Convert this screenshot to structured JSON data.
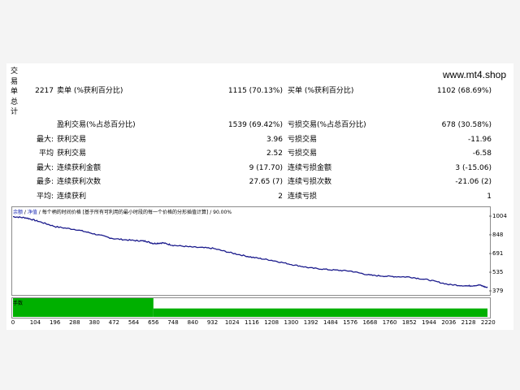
{
  "side_label": "交易单总计",
  "site": "www.mt4.shop",
  "rows": [
    {
      "c1": "2217",
      "c2": "卖单 (%获利百分比)",
      "c3": "1115 (70.13%)",
      "c4": "买单 (%获利百分比)",
      "c5": "1102 (68.69%)"
    },
    {
      "c1": "",
      "c2": "盈利交易(%占总百分比)",
      "c3": "1539 (69.42%)",
      "c4": "亏损交易(%占总百分比)",
      "c5": "678 (30.58%)"
    },
    {
      "c1": "最大:",
      "c2": "获利交易",
      "c3": "3.96",
      "c4": "亏损交易",
      "c5": "-11.96"
    },
    {
      "c1": "平均",
      "c2": "获利交易",
      "c3": "2.52",
      "c4": "亏损交易",
      "c5": "-6.58"
    },
    {
      "c1": "最大:",
      "c2": "连续获利金额",
      "c3": "9 (17.70)",
      "c4": "连续亏损金额",
      "c5": "3 (-15.06)"
    },
    {
      "c1": "最多:",
      "c2": "连续获利次数",
      "c3": "27.65 (7)",
      "c4": "连续亏损次数",
      "c5": "-21.06 (2)"
    },
    {
      "c1": "平均:",
      "c2": "连续获利",
      "c3": "2",
      "c4": "连续亏损",
      "c5": "1"
    }
  ],
  "chart": {
    "title_prefix": "余额",
    "title_sep": " / ",
    "title_mid": "净值",
    "title_rest": " / 每个柄的时间价格 [基于所有可利用的最小时段的每一个价格的分形插值计算] / 90.00%",
    "bar_label": "手数",
    "line_color": "#1a1a8c",
    "bar_color": "#00b000"
  },
  "chart_data": {
    "type": "line",
    "x_ticks": [
      "0",
      "104",
      "196",
      "288",
      "380",
      "472",
      "564",
      "656",
      "748",
      "840",
      "932",
      "1024",
      "1116",
      "1208",
      "1300",
      "1392",
      "1484",
      "1576",
      "1668",
      "1760",
      "1852",
      "1944",
      "2036",
      "2128",
      "2220"
    ],
    "y_ticks": [
      "1004",
      "848",
      "691",
      "535",
      "379"
    ],
    "ylim": [
      379,
      1004
    ],
    "xlim": [
      0,
      2217
    ],
    "series": [
      {
        "values_x": [
          0,
          60,
          120,
          200,
          300,
          380,
          472,
          564,
          620,
          656,
          700,
          748,
          840,
          932,
          1024,
          1116,
          1208,
          1300,
          1392,
          1484,
          1576,
          1668,
          1760,
          1852,
          1944,
          2036,
          2128,
          2180,
          2217
        ],
        "values_y": [
          1000,
          990,
          960,
          915,
          890,
          855,
          815,
          800,
          795,
          775,
          780,
          760,
          745,
          735,
          695,
          660,
          635,
          600,
          570,
          555,
          545,
          510,
          500,
          495,
          470,
          432,
          420,
          428,
          405
        ]
      }
    ],
    "lots": [
      {
        "x_from": 0,
        "x_to": 656,
        "level": 1.0
      },
      {
        "x_from": 656,
        "x_to": 2217,
        "level": 0.45
      }
    ]
  }
}
